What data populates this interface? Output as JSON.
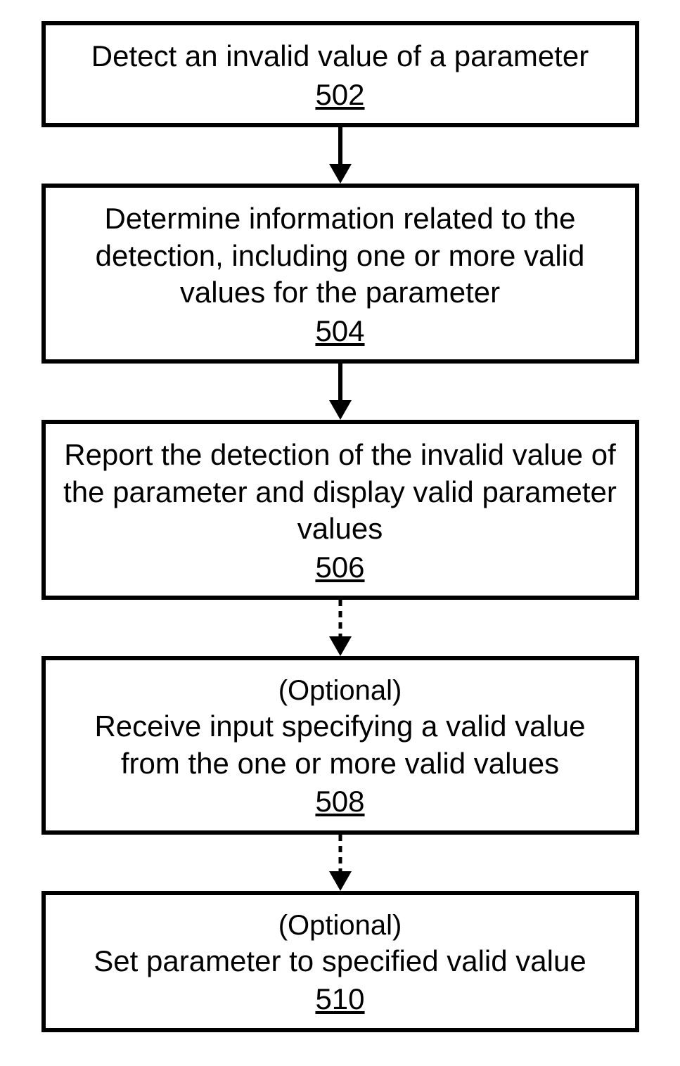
{
  "flow": {
    "steps": [
      {
        "text": "Detect an invalid value of a parameter",
        "num": "502",
        "optional": false
      },
      {
        "text": "Determine information related to the detection, including one or more valid values for the parameter",
        "num": "504",
        "optional": false
      },
      {
        "text": "Report the detection of the invalid value of the parameter and display valid parameter values",
        "num": "506",
        "optional": false
      },
      {
        "text": "Receive input specifying a valid value from the one or more valid values",
        "num": "508",
        "optional": true
      },
      {
        "text": "Set parameter to specified valid value",
        "num": "510",
        "optional": true
      }
    ],
    "optional_label": "(Optional)",
    "connectors": [
      {
        "dashed": false
      },
      {
        "dashed": false
      },
      {
        "dashed": true
      },
      {
        "dashed": true
      }
    ]
  }
}
